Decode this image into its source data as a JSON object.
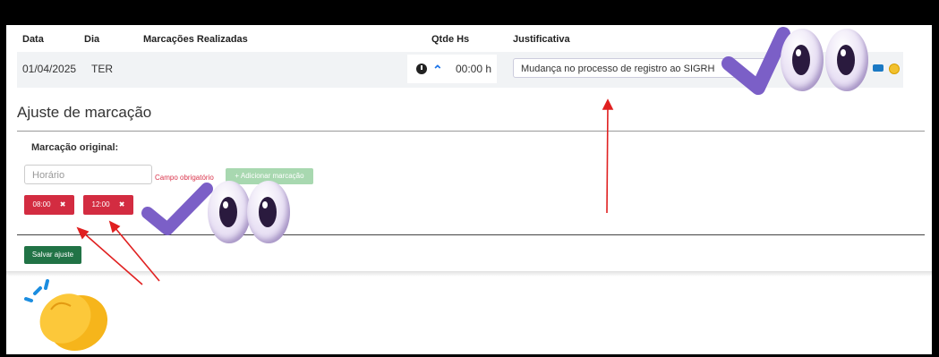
{
  "table": {
    "headers": {
      "date": "Data",
      "day": "Dia",
      "marks": "Marcações Realizadas",
      "hours": "Qtde Hs",
      "justification": "Justificativa"
    },
    "row": {
      "date": "01/04/2025",
      "day": "TER",
      "hours": "00:00 h",
      "justification": "Mudança no processo de registro ao SIGRH"
    }
  },
  "adjust": {
    "title": "Ajuste de marcação",
    "subtitle": "Marcação original:",
    "time_placeholder": "Horário",
    "required_msg": "Campo obrigatório",
    "add_label": "+ Adicionar marcação",
    "tags": [
      {
        "label": "08:00"
      },
      {
        "label": "12:00"
      }
    ],
    "tag_remove": "✖",
    "save_label": "Salvar ajuste"
  },
  "icons": [
    "clock-icon",
    "chevron-up-icon",
    "edit-icon",
    "warning-icon",
    "checkmark-icon",
    "eyes-icon",
    "clapping-hands-icon",
    "arrow-icon"
  ],
  "colors": {
    "accent": "#1a73e8",
    "danger": "#d32c41",
    "success": "#217346",
    "sticker_purple": "#7b5fc7"
  }
}
